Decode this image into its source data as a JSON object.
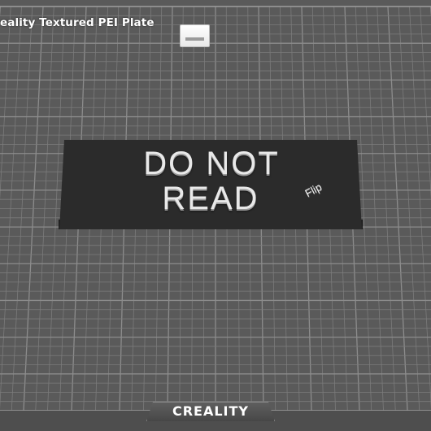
{
  "plate": {
    "label": "eality Textured PEI Plate",
    "icon": "plate-settings-icon"
  },
  "model": {
    "line_1": "DO NOT",
    "line_2": "READ",
    "small_text": "Flip"
  },
  "bed": {
    "brand": "CREALITY"
  },
  "colors": {
    "background": "#5a5a5a",
    "grid_line": "#7b7b7b",
    "model_body": "#2b2b2b",
    "model_text": "#e9e9e9"
  }
}
